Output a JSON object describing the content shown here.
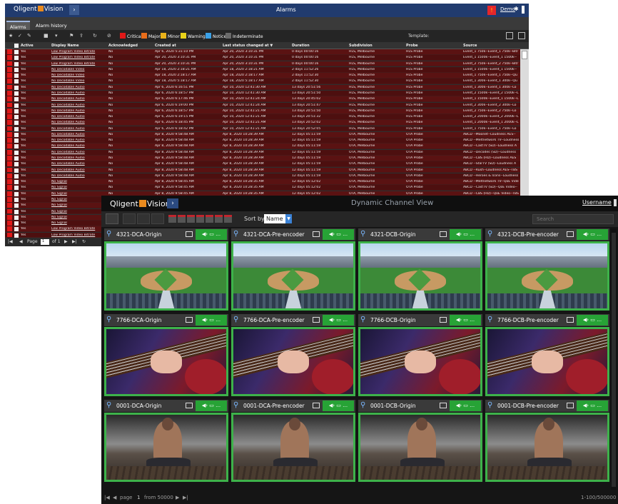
{
  "alarms_window": {
    "brand": "Qligent",
    "product": "Vision",
    "title": "Alarms",
    "user": "Demo",
    "tabs": [
      "Alarms",
      "Alarm history"
    ],
    "severity_filters": [
      {
        "label": "Critical",
        "color": "#e01818"
      },
      {
        "label": "Major",
        "color": "#e86d1a"
      },
      {
        "label": "Minor",
        "color": "#e9b21a"
      },
      {
        "label": "Warning",
        "color": "#e9d21a"
      },
      {
        "label": "Notice",
        "color": "#3aa0e6"
      },
      {
        "label": "Indeterminate",
        "color": "#6a6a6a"
      }
    ],
    "template_label": "Template:",
    "columns": [
      "Active",
      "Display Name",
      "Acknowledged",
      "Created at",
      "Last status changed at ▼",
      "Duration",
      "Subdivision",
      "Probe",
      "Source"
    ],
    "rows": [
      [
        "Yes",
        "Low Program Video Bitrate",
        "No",
        "Apr 6, 2020 5:31:10 PM",
        "Apr 20, 2020 3:10:31 PM",
        "0 days 00:00:16",
        "HLS, Melbourne",
        "HLS Probe",
        "Event_1 750k--Event_1 750k--Bitr"
      ],
      [
        "Yes",
        "Low Program Video Bitrate",
        "No",
        "Apr 20, 2020 3:10:31 PM",
        "Apr 20, 2020 3:10:31 PM",
        "0 days 00:00:16",
        "HLS, Melbourne",
        "HLS Probe",
        "Event_1 1500k--Event_1 1500k--"
      ],
      [
        "Yes",
        "Low Program Video Bitrate",
        "No",
        "Apr 20, 2020 3:10:31 PM",
        "Apr 20, 2020 3:10:31 PM",
        "0 days 00:00:16",
        "HLS, Melbourne",
        "HLS Probe",
        "Event_2 750k--Event_2 750k--Bitr"
      ],
      [
        "Yes",
        "No Decodable Video",
        "No",
        "Apr 18, 2020 2:18:21 AM",
        "Apr 18, 2020 2:18:21 AM",
        "2 days 11:52:26",
        "HLS, Melbourne",
        "HLS Probe",
        "Event_1 1500k--Event_1 1500k--"
      ],
      [
        "Yes",
        "No Decodable Video",
        "No",
        "Apr 18, 2020 2:18:17 AM",
        "Apr 18, 2020 2:18:17 AM",
        "2 days 11:52:30",
        "HLS, Melbourne",
        "HLS Probe",
        "Event_1 750k--Event_1 750k--Qu"
      ],
      [
        "Yes",
        "No Decodable Video",
        "No",
        "Apr 18, 2020 5:18:17 AM",
        "Apr 18, 2020 5:18:17 AM",
        "2 days 11:52:30",
        "HLS, Melbourne",
        "HLS Probe",
        "Event_1 300k--Event_1 300k--Qu"
      ],
      [
        "Yes",
        "No Decodable Audio",
        "No",
        "Apr 6, 2020 6:16:51 PM",
        "Apr 10, 2020 12:41:30 AM",
        "13 days 20:51:56",
        "HLS, Melbourne",
        "HLS Probe",
        "Event_1 300k--Event_1 300k--Lo"
      ],
      [
        "Yes",
        "No Decodable Audio",
        "No",
        "Apr 6, 2020 6:18:57 PM",
        "Apr 10, 2020 12:41:30 AM",
        "13 days 20:51:50",
        "HLS, Melbourne",
        "HLS Probe",
        "Event_2 1500k--Event_2 1500k--L"
      ],
      [
        "Yes",
        "No Decodable Audio",
        "No",
        "Apr 6, 2020 6:17:46 PM",
        "Apr 10, 2020 12:41:24 AM",
        "13 days 20:45:02",
        "HLS, Melbourne",
        "HLS Probe",
        "Event_1 1500k--Event_1 1500k--L"
      ],
      [
        "Yes",
        "No Decodable Audio",
        "No",
        "Apr 6, 2020 6:19:00 PM",
        "Apr 10, 2020 12:41:24 AM",
        "13 days 20:51:47",
        "HLS, Melbourne",
        "HLS Probe",
        "Event_2 300k--Event_2 300k--Lo"
      ],
      [
        "Yes",
        "No Decodable Audio",
        "No",
        "Apr 6, 2020 6:18:57 PM",
        "Apr 10, 2020 12:41:21 AM",
        "13 days 20:51:50",
        "HLS, Melbourne",
        "HLS Probe",
        "Event_2 750k--Event_2 750k--Lo"
      ],
      [
        "Yes",
        "No Decodable Audio",
        "No",
        "Apr 6, 2020 6:19:15 PM",
        "Apr 10, 2020 12:41:21 AM",
        "13 days 20:51:32",
        "HLS, Melbourne",
        "HLS Probe",
        "Event_2 2000k--Event_2 2000k--L"
      ],
      [
        "Yes",
        "No Decodable Audio",
        "No",
        "Apr 6, 2020 6:18:45 PM",
        "Apr 10, 2020 12:41:21 AM",
        "13 days 20:52:02",
        "HLS, Melbourne",
        "HLS Probe",
        "Event_1 2000k--Event_1 2000k--L"
      ],
      [
        "Yes",
        "No Decodable Audio",
        "No",
        "Apr 6, 2020 6:18:42 PM",
        "Apr 10, 2020 12:41:21 AM",
        "13 days 20:52:05",
        "HLS, Melbourne",
        "HLS Probe",
        "Event_1 750k--Event_1 750k--Lo"
      ],
      [
        "Yes",
        "No Decodable Audio",
        "No",
        "Apr 8, 2020 9:58:48 AM",
        "Apr 8, 2020 10:28:39 AM",
        "12 days 05:11:59",
        "OTA, Melbourne",
        "OTA Probe",
        "ABCD --Moonet--Loudness AES--"
      ],
      [
        "Yes",
        "No Decodable Audio",
        "No",
        "Apr 8, 2020 9:58:48 AM",
        "Apr 8, 2020 10:28:39 AM",
        "12 days 05:11:59",
        "OTA, Melbourne",
        "OTA Probe",
        "ABCD --Meltnetwork TV--Loudness"
      ],
      [
        "Yes",
        "No Decodable Audio",
        "No",
        "Apr 8, 2020 9:58:48 AM",
        "Apr 8, 2020 10:28:39 AM",
        "12 days 05:11:59",
        "OTA, Melbourne",
        "OTA Probe",
        "ABCD --CastTV (SD)--Loudness A"
      ],
      [
        "Yes",
        "No Decodable Audio",
        "No",
        "Apr 8, 2020 9:58:48 AM",
        "Apr 8, 2020 10:28:39 AM",
        "12 days 05:11:59",
        "OTA, Melbourne",
        "OTA Probe",
        "ABCD --Decodes (SD)--Loudness"
      ],
      [
        "Yes",
        "No Decodable Audio",
        "No",
        "Apr 8, 2020 9:58:48 AM",
        "Apr 8, 2020 10:28:39 AM",
        "12 days 05:11:59",
        "OTA, Melbourne",
        "OTA Probe",
        "ABCD --CBS (HD)--Loudness AES"
      ],
      [
        "Yes",
        "No Decodable Audio",
        "No",
        "Apr 8, 2020 9:58:48 AM",
        "Apr 8, 2020 10:28:39 AM",
        "12 days 05:11:59",
        "OTA, Melbourne",
        "OTA Probe",
        "ABCD --StarTV (SD)--Loudness A"
      ],
      [
        "Yes",
        "No Decodable Audio",
        "No",
        "Apr 8, 2020 9:58:48 AM",
        "Apr 8, 2020 10:28:39 AM",
        "12 days 05:11:59",
        "OTA, Melbourne",
        "OTA Probe",
        "ABCD --Rush--Loudness AES--TBS"
      ],
      [
        "Yes",
        "No Decodable Audio",
        "No",
        "Apr 8, 2020 9:58:48 AM",
        "Apr 8, 2020 10:28:39 AM",
        "12 days 05:11:59",
        "OTA, Melbourne",
        "OTA Probe",
        "ABCD --Heroes & Icons--Loudness"
      ],
      [
        "Yes",
        "No Signal",
        "No",
        "Apr 8, 2020 9:58:45 AM",
        "Apr 8, 2020 10:28:35 AM",
        "12 days 05:12:02",
        "OTA, Melbourne",
        "OTA Probe",
        "ABCD --Meltnetwork TV--QoE Vide"
      ],
      [
        "Yes",
        "No Signal",
        "No",
        "Apr 8, 2020 9:58:45 AM",
        "Apr 8, 2020 10:28:35 AM",
        "12 days 05:12:02",
        "OTA, Melbourne",
        "OTA Probe",
        "ABCD --CastTV (SD)--QoE Video--"
      ],
      [
        "Yes",
        "No Signal",
        "No",
        "Apr 8, 2020 9:58:45 AM",
        "Apr 8, 2020 10:28:35 AM",
        "12 days 05:12:02",
        "OTA, Melbourne",
        "OTA Probe",
        "ABCD --CBS (HD)--QoE Video--TBS"
      ],
      [
        "Yes",
        "No Signal",
        "",
        "",
        "",
        "",
        "",
        "",
        ""
      ],
      [
        "Yes",
        "No Signal",
        "",
        "",
        "",
        "",
        "",
        "",
        ""
      ],
      [
        "Yes",
        "No Signal",
        "",
        "",
        "",
        "",
        "",
        "",
        ""
      ],
      [
        "Yes",
        "No Signal",
        "",
        "",
        "",
        "",
        "",
        "",
        ""
      ],
      [
        "Yes",
        "No Signal",
        "",
        "",
        "",
        "",
        "",
        "",
        ""
      ],
      [
        "Yes",
        "Low Program Video Bitrate",
        "",
        "",
        "",
        "",
        "",
        "",
        ""
      ],
      [
        "Yes",
        "Low Program Video Bitrate",
        "",
        "",
        "",
        "",
        "",
        "",
        ""
      ]
    ],
    "footer": {
      "page_label": "Page",
      "page_value": "1",
      "of_label": "of 1"
    }
  },
  "dcv_window": {
    "brand": "Qligent",
    "product": "Vision",
    "title": "Dynamic Channel View",
    "user": "Username",
    "sort_label": "Sort by",
    "sort_value": "Name",
    "search_placeholder": "Search",
    "tiles": [
      {
        "name": "4321-DCA-Origin",
        "scene": "baseball"
      },
      {
        "name": "4321-DCA-Pre-encoder",
        "scene": "baseball"
      },
      {
        "name": "4321-DCB-Origin",
        "scene": "baseball"
      },
      {
        "name": "4321-DCB-Pre-encoder",
        "scene": "baseball"
      },
      {
        "name": "7766-DCA-Origin",
        "scene": "guitar"
      },
      {
        "name": "7766-DCA-Pre-encoder",
        "scene": "guitar"
      },
      {
        "name": "7766-DCB-Origin",
        "scene": "guitar"
      },
      {
        "name": "7766-DCB-Pre-encoder",
        "scene": "guitar"
      },
      {
        "name": "0001-DCA-Origin",
        "scene": "runner"
      },
      {
        "name": "0001-DCA-Pre-encoder",
        "scene": "runner"
      },
      {
        "name": "0001-DCB-Origin",
        "scene": "runner"
      },
      {
        "name": "0001-DCB-Pre-encoder",
        "scene": "runner"
      }
    ],
    "tile_status_glyphs": "◀› ▭ …",
    "footer": {
      "page_label": "page",
      "page_value": "1",
      "from_label": "from 50000",
      "range": "1-100/500000"
    }
  }
}
